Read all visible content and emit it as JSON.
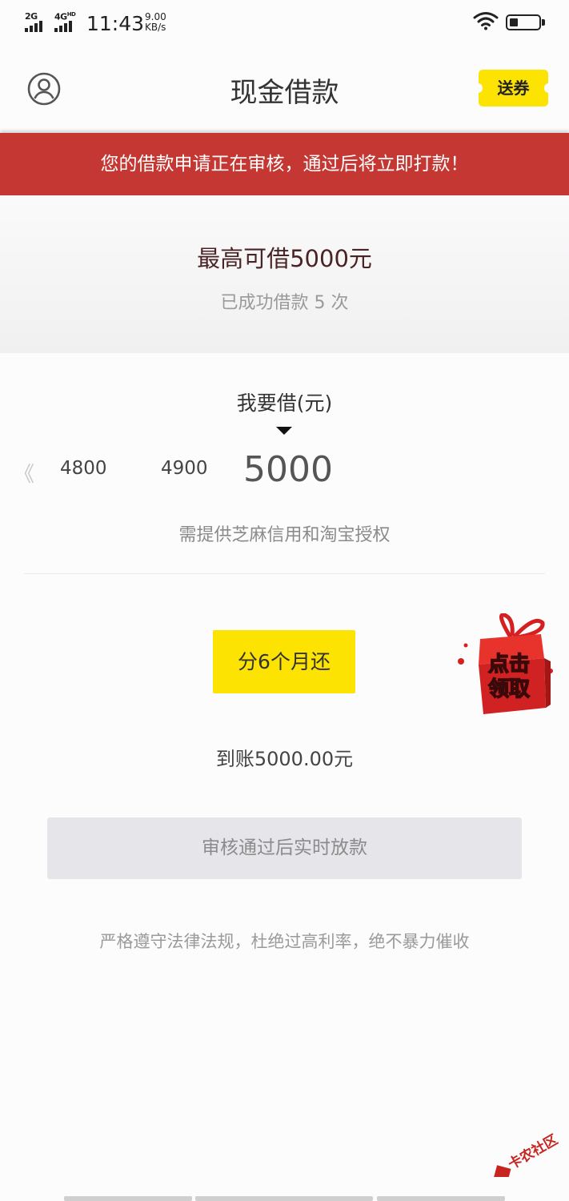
{
  "status_bar": {
    "net1": "2G",
    "net2": "4G",
    "net2_sup": "HD",
    "time": "11:43",
    "speed_value": "9.00",
    "speed_unit": "KB/s",
    "battery_level": 0.3
  },
  "nav": {
    "title": "现金借款",
    "coupon_label": "送券"
  },
  "notice": "您的借款申请正在审核，通过后将立即打款！",
  "credit": {
    "limit_text": "最高可借5000元",
    "count_text": "已成功借款 5 次"
  },
  "amount": {
    "label": "我要借(元)",
    "prev_symbol": "《",
    "options": [
      "4800",
      "4900",
      "5000"
    ],
    "selected": "5000",
    "auth_note": "需提供芝麻信用和淘宝授权"
  },
  "installment": {
    "term_label": "分6个月还",
    "received": "到账5000.00元",
    "gift_line1": "点击",
    "gift_line2": "领取"
  },
  "submit_label": "审核通过后实时放款",
  "compliance": "严格遵守法律法规，杜绝过高利率，绝不暴力催收",
  "watermark": "卡农社区",
  "colors": {
    "notice_bg": "#c43732",
    "accent_yellow": "#fde302",
    "disabled_button": "#e6e5e9"
  }
}
